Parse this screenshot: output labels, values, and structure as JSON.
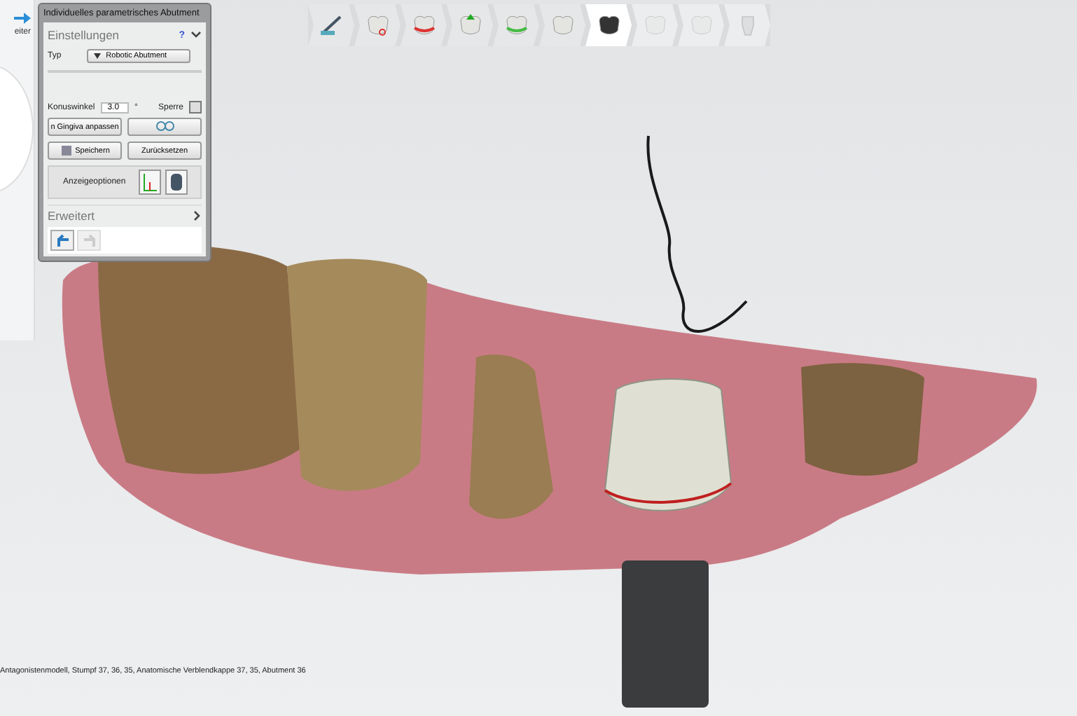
{
  "left_panel": {
    "next_label": "eiter"
  },
  "toolbar": {
    "steps": [
      {
        "kind": "scan",
        "selected": false,
        "disabled": false
      },
      {
        "kind": "separate",
        "selected": false,
        "disabled": false
      },
      {
        "kind": "margin",
        "selected": false,
        "disabled": false
      },
      {
        "kind": "insertion",
        "selected": false,
        "disabled": false
      },
      {
        "kind": "gingiva",
        "selected": false,
        "disabled": false
      },
      {
        "kind": "crown",
        "selected": false,
        "disabled": false
      },
      {
        "kind": "abutment",
        "selected": true,
        "disabled": false
      },
      {
        "kind": "crown",
        "selected": false,
        "disabled": true
      },
      {
        "kind": "crown",
        "selected": false,
        "disabled": true
      },
      {
        "kind": "implant",
        "selected": false,
        "disabled": true
      }
    ]
  },
  "panel": {
    "title": "Individuelles parametrisches Abutment",
    "section": "Einstellungen",
    "help": "?",
    "expanded": true,
    "type_label": "Typ",
    "type_value": "Robotic Abutment",
    "angle_label": "Konuswinkel",
    "angle_value": "3.0",
    "angle_unit": "°",
    "lock_label": "Sperre",
    "lock_checked": false,
    "buttons": [
      {
        "kind": "text",
        "label": "n Gingiva anpassen"
      },
      {
        "kind": "icon"
      },
      {
        "kind": "save",
        "label": "Speichern"
      },
      {
        "kind": "text",
        "label": "Zurücksetzen"
      }
    ],
    "display_label": "Anzeigeoptionen",
    "advanced": "Erweitert",
    "advanced_expanded": false,
    "undo_enabled": true,
    "redo_enabled": false
  },
  "status_bar": {
    "text": "Antagonistenmodell, Stumpf 37, 36, 35, Anatomische Verblendkappe 37, 35, Abutment 36"
  }
}
